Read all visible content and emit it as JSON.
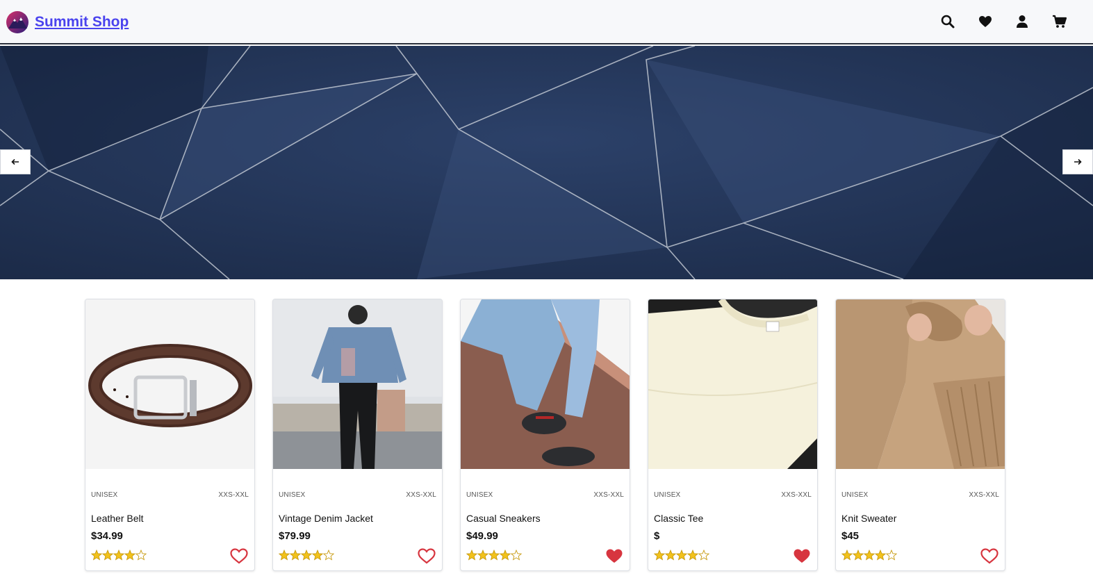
{
  "header": {
    "brand": "Summit Shop",
    "icons": [
      "search-icon",
      "heart-icon",
      "user-icon",
      "cart-icon"
    ]
  },
  "hero": {
    "prev_icon": "arrow-left-icon",
    "next_icon": "arrow-right-icon"
  },
  "products": [
    {
      "gender": "UNISEX",
      "sizes": "XXS-XXL",
      "name": "Leather Belt",
      "price": "$34.99",
      "rating": 4,
      "favorited": false
    },
    {
      "gender": "UNISEX",
      "sizes": "XXS-XXL",
      "name": "Vintage Denim Jacket",
      "price": "$79.99",
      "rating": 4,
      "favorited": false
    },
    {
      "gender": "UNISEX",
      "sizes": "XXS-XXL",
      "name": "Casual Sneakers",
      "price": "$49.99",
      "rating": 4,
      "favorited": true
    },
    {
      "gender": "UNISEX",
      "sizes": "XXS-XXL",
      "name": "Classic Tee",
      "price": "$",
      "rating": 4,
      "favorited": true
    },
    {
      "gender": "UNISEX",
      "sizes": "XXS-XXL",
      "name": "Knit Sweater",
      "price": "$45",
      "rating": 4,
      "favorited": false
    }
  ],
  "colors": {
    "brand": "#4a43ee",
    "heart": "#d7353f",
    "star": "#f2c21b",
    "hero": "#24375a"
  }
}
